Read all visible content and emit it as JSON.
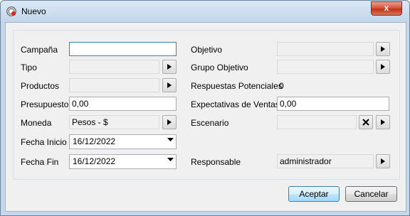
{
  "window": {
    "title": "Nuevo",
    "close_label": "x"
  },
  "form": {
    "campana_label": "Campaña",
    "campana_value": "",
    "tipo_label": "Tipo",
    "tipo_value": "",
    "productos_label": "Productos",
    "productos_value": "",
    "presupuesto_label": "Presupuesto",
    "presupuesto_value": "0,00",
    "moneda_label": "Moneda",
    "moneda_value": "Pesos - $",
    "fecha_inicio_label": "Fecha Inicio",
    "fecha_inicio_value": "16/12/2022",
    "fecha_fin_label": "Fecha Fin",
    "fecha_fin_value": "16/12/2022",
    "objetivo_label": "Objetivo",
    "objetivo_value": "",
    "grupo_objetivo_label": "Grupo Objetivo",
    "grupo_objetivo_value": "",
    "respuestas_label": "Respuestas Potenciales",
    "respuestas_value": "0",
    "expectativas_label": "Expectativas de Ventas",
    "expectativas_value": "0,00",
    "escenario_label": "Escenario",
    "escenario_value": "",
    "responsable_label": "Responsable",
    "responsable_value": "administrador"
  },
  "buttons": {
    "accept": "Aceptar",
    "cancel": "Cancelar"
  },
  "icons": {
    "app": "app-logo-icon",
    "picker": "arrow-right-icon",
    "clear": "x-clear-icon",
    "dropdown": "chevron-down-icon"
  },
  "colors": {
    "titlebar": "#c3d6ea",
    "close": "#c23219",
    "default_button": "#bee6fd",
    "focus_border": "#3c7fb1"
  }
}
